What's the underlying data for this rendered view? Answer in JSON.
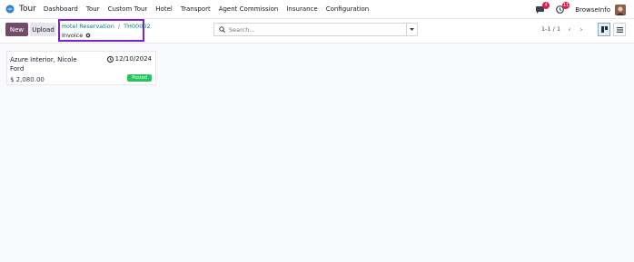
{
  "nav": {
    "app_name": "Tour",
    "menu": [
      "Dashboard",
      "Tour",
      "Custom Tour",
      "Hotel",
      "Transport",
      "Agent Commission",
      "Insurance",
      "Configuration"
    ],
    "chat_badge": "4",
    "activity_badge": "11",
    "company": "BrowseInfo"
  },
  "control": {
    "new_label": "New",
    "upload_label": "Upload",
    "breadcrumb_parent": "Hotel Reservation",
    "breadcrumb_record": "TH00002",
    "breadcrumb_current": "Invoice",
    "search_placeholder": "Search...",
    "pager": "1-1 / 1"
  },
  "cards": [
    {
      "partner": "Azure Interior, Nicole Ford",
      "date": "12/10/2024",
      "amount": "$ 2,080.00",
      "status": "Posted",
      "status_color": "#22c55e"
    }
  ],
  "colors": {
    "primary": "#714b67",
    "link": "#017e84",
    "highlight_border": "#7e22ce"
  }
}
